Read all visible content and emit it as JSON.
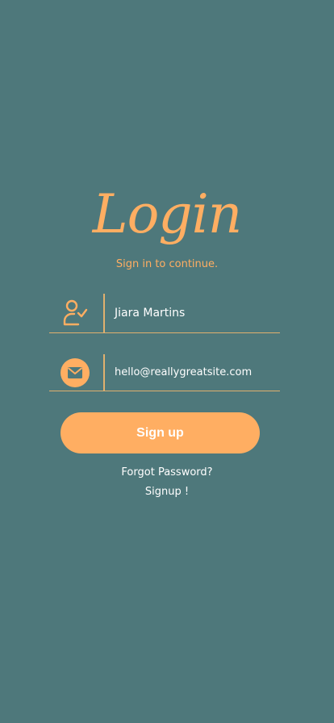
{
  "login": {
    "title": "Login",
    "subtitle": "Sign in to continue.",
    "name_value": "Jiara Martins",
    "email_value": "hello@reallygreatsite.com",
    "signup_button": "Sign up",
    "forgot_link": "Forgot Password?",
    "signup_link": "Signup !"
  },
  "icons": {
    "name_field": "user-check-icon",
    "email_field": "envelope-icon"
  },
  "colors": {
    "background": "#4e787b",
    "accent": "#ffae62",
    "text": "#ffffff"
  }
}
